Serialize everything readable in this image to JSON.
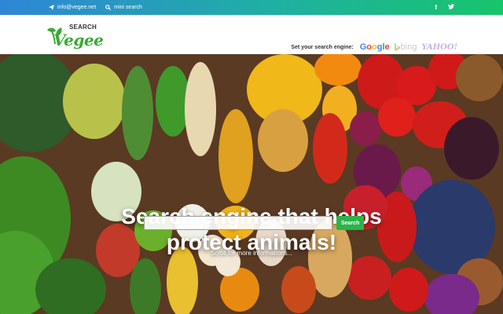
{
  "topbar": {
    "email": "info@vegee.net",
    "mini_search": "mini search",
    "facebook": "f",
    "twitter": "t"
  },
  "logo": {
    "search_word": "SEARCH",
    "brand": "Vegee"
  },
  "engines": {
    "label": "Set your search engine:",
    "bing": "bing",
    "yahoo": "YAHOO!",
    "google_letters": [
      "G",
      "o",
      "o",
      "g",
      "l",
      "e"
    ],
    "google_colors": [
      "#4285F4",
      "#EA4335",
      "#FBBC05",
      "#4285F4",
      "#34A853",
      "#EA4335"
    ]
  },
  "hero": {
    "headline_line1": "Search engine that helps",
    "headline_line2": "protect animals!",
    "search_placeholder": "",
    "search_button": "Search",
    "scroll_text": "Scroll for more informations..."
  },
  "colors": {
    "accent_green": "#2db34a",
    "topbar_start": "#2f86d6",
    "topbar_end": "#18c46b"
  }
}
